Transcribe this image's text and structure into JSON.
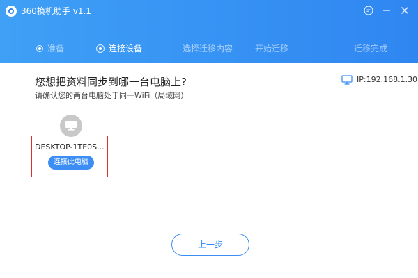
{
  "app": {
    "title": "360换机助手 v1.1",
    "accent_color": "#2f86f1"
  },
  "window_controls": {
    "feedback_icon": "chat-bubble-icon",
    "minimize_icon": "minimize-icon",
    "close_icon": "close-icon"
  },
  "steps": [
    {
      "label": "准备",
      "state": "done"
    },
    {
      "label": "连接设备",
      "state": "active"
    },
    {
      "label": "选择迁移内容",
      "state": "pending"
    },
    {
      "label": "开始迁移",
      "state": "pending"
    },
    {
      "label": "迁移完成",
      "state": "pending"
    }
  ],
  "main": {
    "question": "您想把资料同步到哪一台电脑上?",
    "instruction": "请确认您的两台电脑处于同一WiFi（局域网）",
    "ip_label": "IP:192.168.1.30"
  },
  "device": {
    "name": "DESKTOP-1TE0S...",
    "connect_label": "连接此电脑",
    "highlight_color": "#d9312e"
  },
  "footer": {
    "back_label": "上一步"
  }
}
